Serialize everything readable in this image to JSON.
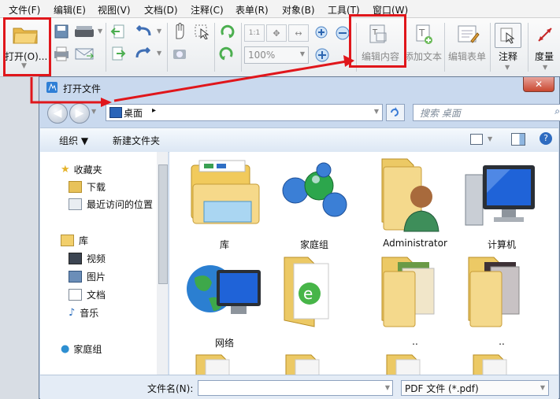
{
  "menu": [
    "文件(F)",
    "编辑(E)",
    "视图(V)",
    "文档(D)",
    "注释(C)",
    "表单(R)",
    "对象(B)",
    "工具(T)",
    "窗口(W)"
  ],
  "ribbon": {
    "open_label": "打开(O)...",
    "zoom_value": "100%",
    "edit_content_label": "编辑内容",
    "add_text_label": "添加文本",
    "edit_form_label": "编辑表单",
    "comment_label": "注释",
    "measure_label": "度量"
  },
  "dialog": {
    "title": "打开文件",
    "close_symbol": "✕",
    "address_text": "桌面",
    "search_placeholder": "搜索 桌面",
    "organize_label": "组织 ▼",
    "new_folder_label": "新建文件夹",
    "nav": {
      "favorites": "收藏夹",
      "downloads": "下载",
      "recent": "最近访问的位置",
      "libraries": "库",
      "videos": "视频",
      "pictures": "图片",
      "documents": "文档",
      "music": "音乐",
      "homegroup": "家庭组"
    },
    "files": [
      "库",
      "家庭组",
      "Administrator",
      "计算机",
      "网络",
      "",
      "..",
      "..",
      "",
      "",
      "",
      ""
    ],
    "filename_label": "文件名(N):",
    "filename_value": "",
    "filetype_value": "PDF 文件 (*.pdf)"
  },
  "colors": {
    "annotation_red": "#e0161b",
    "dialog_frame": "#c9d9ee",
    "folder_yellow": "#f2cf6b"
  }
}
